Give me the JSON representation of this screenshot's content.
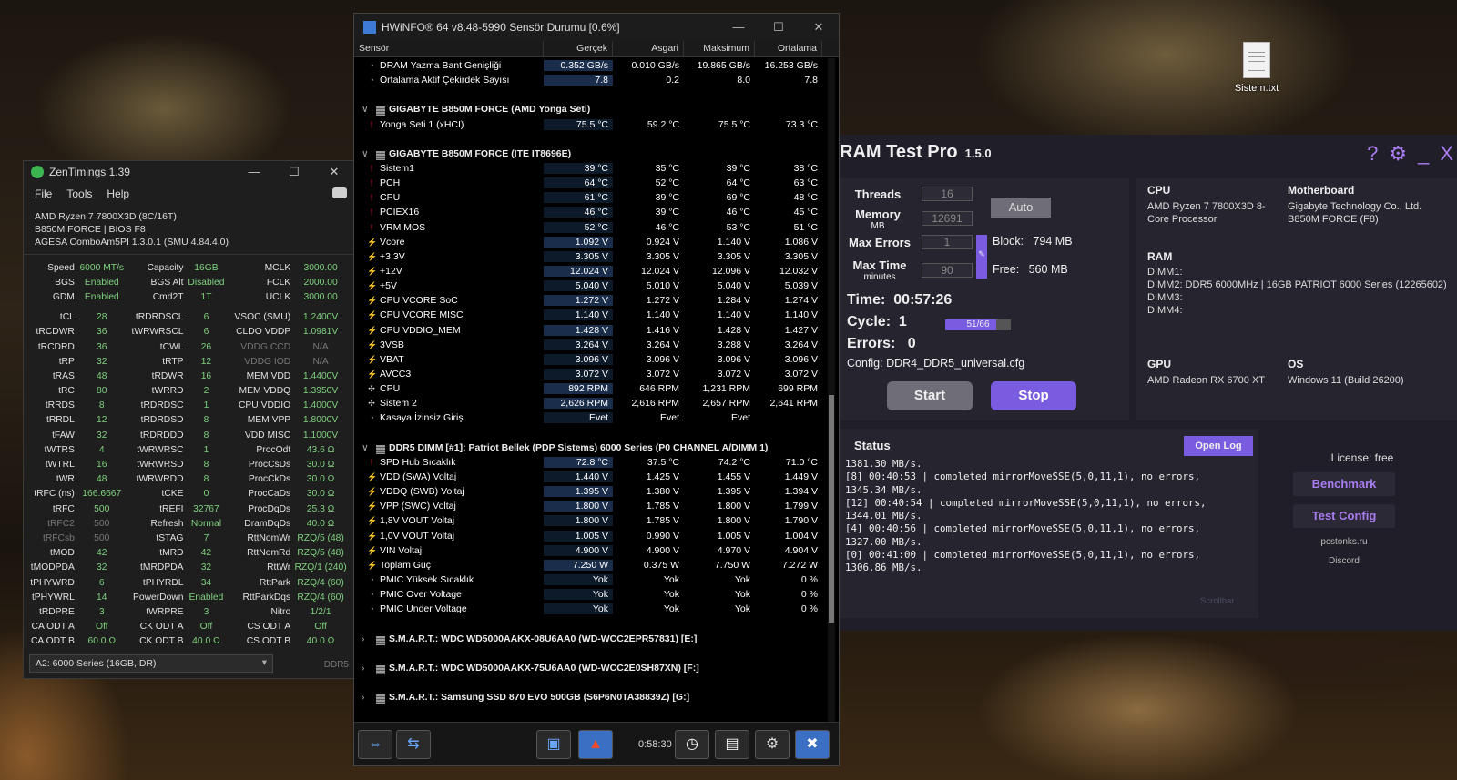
{
  "desktop": {
    "file_label": "Sistem.txt"
  },
  "zen": {
    "title": "ZenTimings 1.39",
    "menu": [
      "File",
      "Tools",
      "Help"
    ],
    "info": [
      "AMD Ryzen 7 7800X3D (8C/16T)",
      "B850M FORCE | BIOS F8",
      "AGESA ComboAm5PI 1.3.0.1 (SMU 4.84.4.0)"
    ],
    "rows": [
      [
        "Speed",
        "6000 MT/s",
        "Capacity",
        "16GB",
        "MCLK",
        "3000.00"
      ],
      [
        "BGS",
        "Enabled",
        "BGS Alt",
        "Disabled",
        "FCLK",
        "2000.00"
      ],
      [
        "GDM",
        "Enabled",
        "Cmd2T",
        "1T",
        "UCLK",
        "3000.00"
      ],
      [
        "tCL",
        "28",
        "tRDRDSCL",
        "6",
        "VSOC (SMU)",
        "1.2400V"
      ],
      [
        "tRCDWR",
        "36",
        "tWRWRSCL",
        "6",
        "CLDO VDDP",
        "1.0981V"
      ],
      [
        "tRCDRD",
        "36",
        "tCWL",
        "26",
        "VDDG CCD",
        "N/A"
      ],
      [
        "tRP",
        "32",
        "tRTP",
        "12",
        "VDDG IOD",
        "N/A"
      ],
      [
        "tRAS",
        "48",
        "tRDWR",
        "16",
        "MEM VDD",
        "1.4400V"
      ],
      [
        "tRC",
        "80",
        "tWRRD",
        "2",
        "MEM VDDQ",
        "1.3950V"
      ],
      [
        "tRRDS",
        "8",
        "tRDRDSC",
        "1",
        "CPU VDDIO",
        "1.4000V"
      ],
      [
        "tRRDL",
        "12",
        "tRDRDSD",
        "8",
        "MEM VPP",
        "1.8000V"
      ],
      [
        "tFAW",
        "32",
        "tRDRDDD",
        "8",
        "VDD MISC",
        "1.1000V"
      ],
      [
        "tWTRS",
        "4",
        "tWRWRSC",
        "1",
        "ProcOdt",
        "43.6 Ω"
      ],
      [
        "tWTRL",
        "16",
        "tWRWRSD",
        "8",
        "ProcCsDs",
        "30.0 Ω"
      ],
      [
        "tWR",
        "48",
        "tWRWRDD",
        "8",
        "ProcCkDs",
        "30.0 Ω"
      ],
      [
        "tRFC (ns)",
        "166.6667",
        "tCKE",
        "0",
        "ProcCaDs",
        "30.0 Ω"
      ],
      [
        "tRFC",
        "500",
        "tREFI",
        "32767",
        "ProcDqDs",
        "25.3 Ω"
      ],
      [
        "tRFC2",
        "500",
        "Refresh",
        "Normal",
        "DramDqDs",
        "40.0 Ω"
      ],
      [
        "tRFCsb",
        "500",
        "tSTAG",
        "7",
        "RttNomWr",
        "RZQ/5 (48)"
      ],
      [
        "tMOD",
        "42",
        "tMRD",
        "42",
        "RttNomRd",
        "RZQ/5 (48)"
      ],
      [
        "tMODPDA",
        "32",
        "tMRDPDA",
        "32",
        "RttWr",
        "RZQ/1 (240)"
      ],
      [
        "tPHYWRD",
        "6",
        "tPHYRDL",
        "34",
        "RttPark",
        "RZQ/4 (60)"
      ],
      [
        "tPHYWRL",
        "14",
        "PowerDown",
        "Enabled",
        "RttParkDqs",
        "RZQ/4 (60)"
      ],
      [
        "tRDPRE",
        "3",
        "tWRPRE",
        "3",
        "Nitro",
        "1/2/1"
      ],
      [
        "CA ODT A",
        "Off",
        "CK ODT A",
        "Off",
        "CS ODT A",
        "Off"
      ],
      [
        "CA ODT B",
        "60.0 Ω",
        "CK ODT B",
        "40.0 Ω",
        "CS ODT B",
        "40.0 Ω"
      ]
    ],
    "select": "A2: 6000 Series (16GB, DR)",
    "ddr": "DDR5"
  },
  "hw": {
    "title": "HWiNFO® 64 v8.48-5990 Sensör Durumu [0.6%]",
    "headers": [
      "Sensör",
      "Gerçek",
      "Asgari",
      "Maksimum",
      "Ortalama"
    ],
    "rows": [
      {
        "t": "c",
        "n": "DRAM Yazma Bant Genişliği",
        "v": [
          "0.352 GB/s",
          "0.010 GB/s",
          "19.865 GB/s",
          "16.253 GB/s"
        ]
      },
      {
        "t": "c",
        "n": "Ortalama Aktif Çekirdek Sayısı",
        "v": [
          "7.8",
          "0.2",
          "8.0",
          "7.8"
        ]
      },
      {
        "t": "blank"
      },
      {
        "t": "grp",
        "n": "GIGABYTE B850M FORCE (AMD Yonga Seti)"
      },
      {
        "t": "t",
        "n": "Yonga Seti 1 (xHCI)",
        "v": [
          "75.5 °C",
          "59.2 °C",
          "75.5 °C",
          "73.3 °C"
        ]
      },
      {
        "t": "blank"
      },
      {
        "t": "grp",
        "n": "GIGABYTE B850M FORCE (ITE IT8696E)"
      },
      {
        "t": "t",
        "n": "Sistem1",
        "v": [
          "39 °C",
          "35 °C",
          "39 °C",
          "38 °C"
        ]
      },
      {
        "t": "t",
        "n": "PCH",
        "v": [
          "64 °C",
          "52 °C",
          "64 °C",
          "63 °C"
        ]
      },
      {
        "t": "t",
        "n": "CPU",
        "v": [
          "61 °C",
          "39 °C",
          "69 °C",
          "48 °C"
        ]
      },
      {
        "t": "t",
        "n": "PCIEX16",
        "v": [
          "46 °C",
          "39 °C",
          "46 °C",
          "45 °C"
        ]
      },
      {
        "t": "t",
        "n": "VRM MOS",
        "v": [
          "52 °C",
          "46 °C",
          "53 °C",
          "51 °C"
        ]
      },
      {
        "t": "v",
        "n": "Vcore",
        "v": [
          "1.092 V",
          "0.924 V",
          "1.140 V",
          "1.086 V"
        ]
      },
      {
        "t": "v",
        "n": "+3,3V",
        "v": [
          "3.305 V",
          "3.305 V",
          "3.305 V",
          "3.305 V"
        ]
      },
      {
        "t": "v",
        "n": "+12V",
        "v": [
          "12.024 V",
          "12.024 V",
          "12.096 V",
          "12.032 V"
        ]
      },
      {
        "t": "v",
        "n": "+5V",
        "v": [
          "5.040 V",
          "5.010 V",
          "5.040 V",
          "5.039 V"
        ]
      },
      {
        "t": "v",
        "n": "CPU VCORE SoC",
        "v": [
          "1.272 V",
          "1.272 V",
          "1.284 V",
          "1.274 V"
        ]
      },
      {
        "t": "v",
        "n": "CPU VCORE MISC",
        "v": [
          "1.140 V",
          "1.140 V",
          "1.140 V",
          "1.140 V"
        ]
      },
      {
        "t": "v",
        "n": "CPU VDDIO_MEM",
        "v": [
          "1.428 V",
          "1.416 V",
          "1.428 V",
          "1.427 V"
        ]
      },
      {
        "t": "v",
        "n": "3VSB",
        "v": [
          "3.264 V",
          "3.264 V",
          "3.288 V",
          "3.264 V"
        ]
      },
      {
        "t": "v",
        "n": "VBAT",
        "v": [
          "3.096 V",
          "3.096 V",
          "3.096 V",
          "3.096 V"
        ]
      },
      {
        "t": "v",
        "n": "AVCC3",
        "v": [
          "3.072 V",
          "3.072 V",
          "3.072 V",
          "3.072 V"
        ]
      },
      {
        "t": "f",
        "n": "CPU",
        "v": [
          "892 RPM",
          "646 RPM",
          "1,231 RPM",
          "699 RPM"
        ]
      },
      {
        "t": "f",
        "n": "Sistem 2",
        "v": [
          "2,626 RPM",
          "2,616 RPM",
          "2,657 RPM",
          "2,641 RPM"
        ]
      },
      {
        "t": "c",
        "n": "Kasaya İzinsiz Giriş",
        "v": [
          "Evet",
          "Evet",
          "Evet",
          ""
        ]
      },
      {
        "t": "blank"
      },
      {
        "t": "grp",
        "n": "DDR5 DIMM [#1]: Patriot Bellek (PDP Sistems) 6000 Series (P0 CHANNEL A/DIMM 1)"
      },
      {
        "t": "t",
        "n": "SPD Hub Sıcaklık",
        "v": [
          "72.8 °C",
          "37.5 °C",
          "74.2 °C",
          "71.0 °C"
        ]
      },
      {
        "t": "v",
        "n": "VDD (SWA) Voltaj",
        "v": [
          "1.440 V",
          "1.425 V",
          "1.455 V",
          "1.449 V"
        ]
      },
      {
        "t": "v",
        "n": "VDDQ (SWB) Voltaj",
        "v": [
          "1.395 V",
          "1.380 V",
          "1.395 V",
          "1.394 V"
        ]
      },
      {
        "t": "v",
        "n": "VPP (SWC) Voltaj",
        "v": [
          "1.800 V",
          "1.785 V",
          "1.800 V",
          "1.799 V"
        ]
      },
      {
        "t": "v",
        "n": "1,8V VOUT Voltaj",
        "v": [
          "1.800 V",
          "1.785 V",
          "1.800 V",
          "1.790 V"
        ]
      },
      {
        "t": "v",
        "n": "1,0V VOUT Voltaj",
        "v": [
          "1.005 V",
          "0.990 V",
          "1.005 V",
          "1.004 V"
        ]
      },
      {
        "t": "v",
        "n": "VIN Voltaj",
        "v": [
          "4.900 V",
          "4.900 V",
          "4.970 V",
          "4.904 V"
        ]
      },
      {
        "t": "v",
        "n": "Toplam Güç",
        "v": [
          "7.250 W",
          "0.375 W",
          "7.750 W",
          "7.272 W"
        ]
      },
      {
        "t": "c",
        "n": "PMIC Yüksek Sıcaklık",
        "v": [
          "Yok",
          "Yok",
          "Yok",
          "0 %"
        ]
      },
      {
        "t": "c",
        "n": "PMIC Over Voltage",
        "v": [
          "Yok",
          "Yok",
          "Yok",
          "0 %"
        ]
      },
      {
        "t": "c",
        "n": "PMIC Under Voltage",
        "v": [
          "Yok",
          "Yok",
          "Yok",
          "0 %"
        ]
      },
      {
        "t": "blank"
      },
      {
        "t": "grpc",
        "n": "S.M.A.R.T.: WDC WD5000AAKX-08U6AA0 (WD-WCC2EPR57831) [E:]"
      },
      {
        "t": "blank"
      },
      {
        "t": "grpc",
        "n": "S.M.A.R.T.: WDC WD5000AAKX-75U6AA0 (WD-WCC2E0SH87XN) [F:]"
      },
      {
        "t": "blank"
      },
      {
        "t": "grpc",
        "n": "S.M.A.R.T.: Samsung SSD 870 EVO 500GB (S6P6N0TA38839Z) [G:]"
      }
    ],
    "time": "0:58:30"
  },
  "rtp": {
    "title": "RAM Test Pro",
    "version": "1.5.0",
    "threads_label": "Threads",
    "threads": "16",
    "memory_label": "Memory",
    "memory_unit": "MB",
    "memory": "12691",
    "maxerr_label": "Max Errors",
    "maxerr": "1",
    "maxtime_label": "Max Time",
    "maxtime_unit": "minutes",
    "maxtime": "90",
    "auto": "Auto",
    "block_label": "Block:",
    "block": "794 MB",
    "free_label": "Free:",
    "free": "560 MB",
    "time_label": "Time:",
    "time": "00:57:26",
    "cycle_label": "Cycle:",
    "cycle": "1",
    "cycle_progress": "51/66",
    "cycle_fraction": 0.7727,
    "errors_label": "Errors:",
    "errors": "0",
    "config": "Config: DDR4_DDR5_universal.cfg",
    "start": "Start",
    "stop": "Stop",
    "cpu_h": "CPU",
    "cpu": "AMD Ryzen 7 7800X3D 8-Core Processor",
    "mb_h": "Motherboard",
    "mb": "Gigabyte Technology Co., Ltd. B850M FORCE (F8)",
    "ram_h": "RAM",
    "ram": "DIMM1:\nDIMM2: DDR5 6000MHz | 16GB PATRIOT 6000 Series (12265602)\nDIMM3:\nDIMM4:",
    "gpu_h": "GPU",
    "gpu": "AMD Radeon RX 6700 XT",
    "os_h": "OS",
    "os": "Windows 11 (Build 26200)",
    "status_h": "Status",
    "open_log": "Open Log",
    "log": "1381.30 MB/s.\n[8] 00:40:53 | completed mirrorMoveSSE(5,0,11,1), no errors,\n1345.34 MB/s.\n[12] 00:40:54 | completed mirrorMoveSSE(5,0,11,1), no errors,\n1344.01 MB/s.\n[4] 00:40:56 | completed mirrorMoveSSE(5,0,11,1), no errors,\n1327.00 MB/s.\n[0] 00:41:00 | completed mirrorMoveSSE(5,0,11,1), no errors,\n1306.86 MB/s.",
    "scrollbar": "Scrollbar",
    "license": "License: free",
    "benchmark": "Benchmark",
    "test_config": "Test Config",
    "site": "pcstonks.ru",
    "discord": "Discord",
    "accent": "#7a5ce0"
  }
}
